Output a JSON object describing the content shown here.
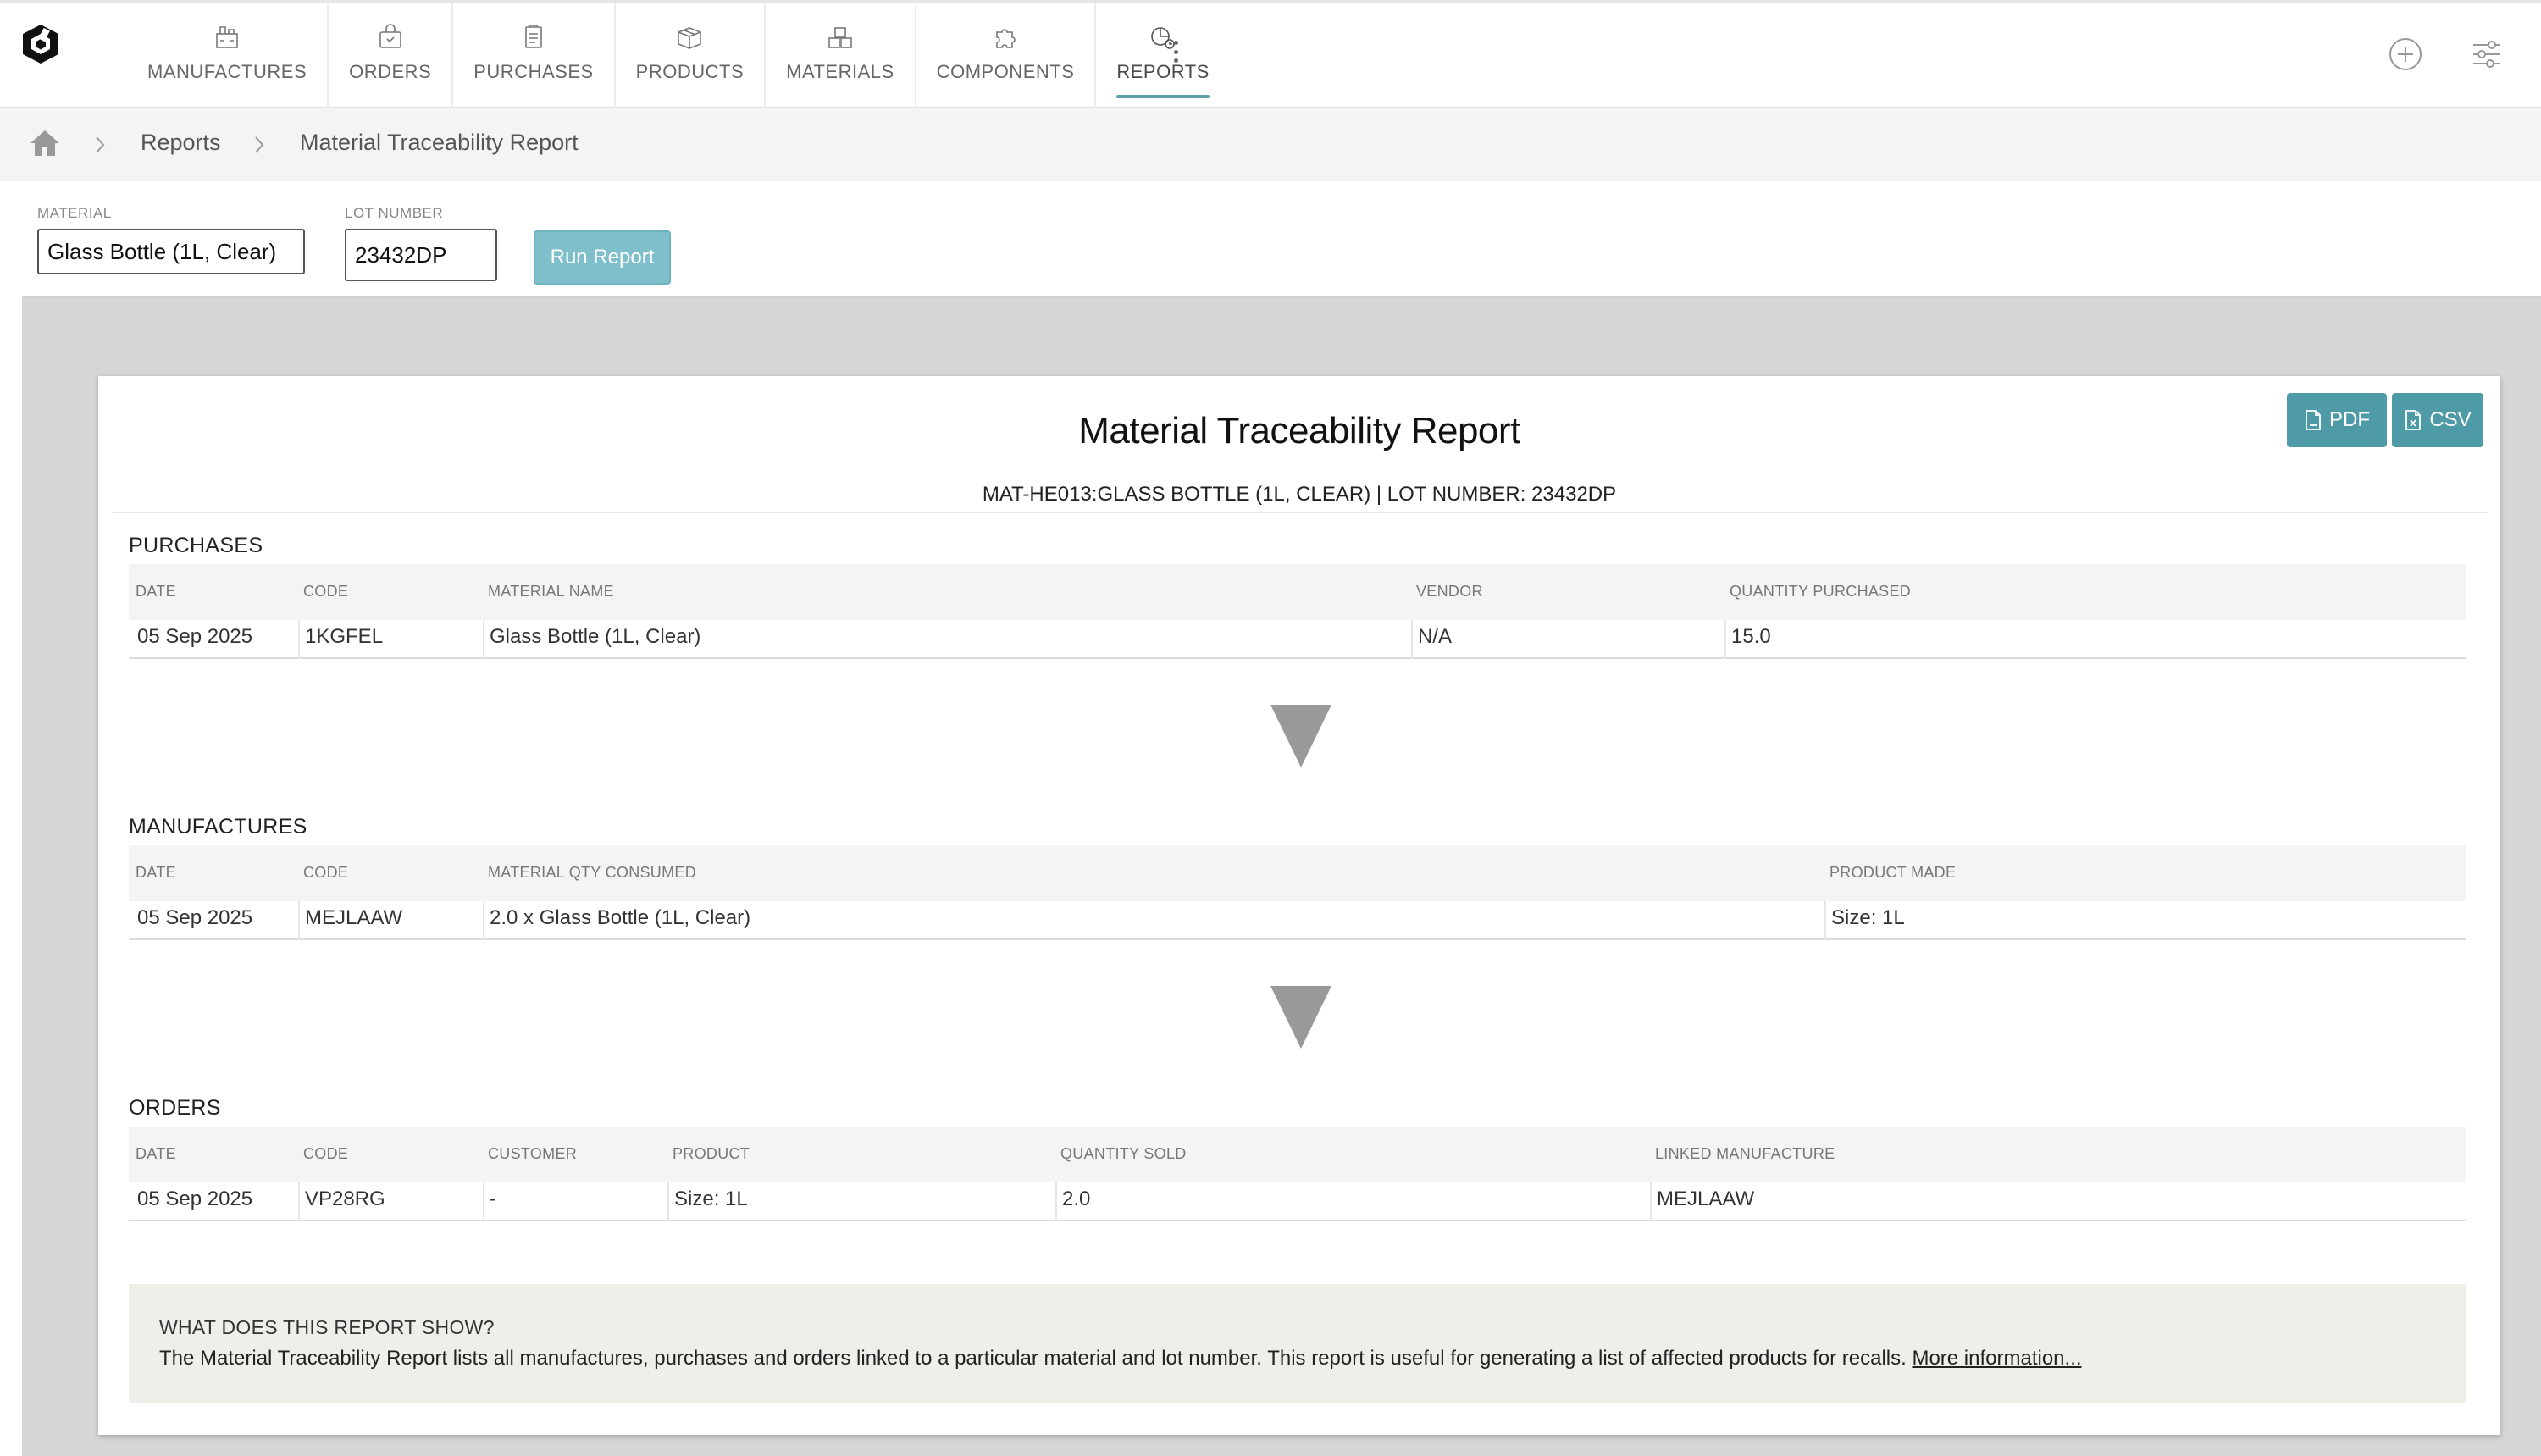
{
  "nav": {
    "items": [
      {
        "label": "MANUFACTURES",
        "icon": "factory-icon"
      },
      {
        "label": "ORDERS",
        "icon": "cart-icon"
      },
      {
        "label": "PURCHASES",
        "icon": "clipboard-icon"
      },
      {
        "label": "PRODUCTS",
        "icon": "box-icon"
      },
      {
        "label": "MATERIALS",
        "icon": "boxes-icon"
      },
      {
        "label": "COMPONENTS",
        "icon": "puzzle-icon"
      },
      {
        "label": "REPORTS",
        "icon": "report-chart-icon",
        "active": true
      }
    ],
    "accent": "#5a9fa8"
  },
  "breadcrumb": {
    "items": [
      "Reports",
      "Material Traceability Report"
    ]
  },
  "filters": {
    "material_label": "MATERIAL",
    "material_value": "Glass Bottle (1L, Clear)",
    "lot_label": "LOT NUMBER",
    "lot_value": "23432DP",
    "run_label": "Run Report"
  },
  "report": {
    "pdf_label": "PDF",
    "csv_label": "CSV",
    "title": "Material Traceability Report",
    "subtitle": "MAT-HE013:GLASS BOTTLE (1L, CLEAR) | LOT NUMBER: 23432DP",
    "purchases": {
      "title": "PURCHASES",
      "headers": [
        "DATE",
        "CODE",
        "MATERIAL NAME",
        "VENDOR",
        "QUANTITY PURCHASED"
      ],
      "rows": [
        [
          "05 Sep 2025",
          "1KGFEL",
          "Glass Bottle (1L, Clear)",
          "N/A",
          "15.0"
        ]
      ]
    },
    "manufactures": {
      "title": "MANUFACTURES",
      "headers": [
        "DATE",
        "CODE",
        "MATERIAL QTY CONSUMED",
        "PRODUCT MADE"
      ],
      "rows": [
        [
          "05 Sep 2025",
          "MEJLAAW",
          "2.0 x Glass Bottle (1L, Clear)",
          "Size: 1L"
        ]
      ]
    },
    "orders": {
      "title": "ORDERS",
      "headers": [
        "DATE",
        "CODE",
        "CUSTOMER",
        "PRODUCT",
        "QUANTITY SOLD",
        "LINKED MANUFACTURE"
      ],
      "rows": [
        [
          "05 Sep 2025",
          "VP28RG",
          "-",
          "Size: 1L",
          "2.0",
          "MEJLAAW"
        ]
      ]
    },
    "info": {
      "title": "WHAT DOES THIS REPORT SHOW?",
      "text": "The Material Traceability Report lists all manufactures, purchases and orders linked to a particular material and lot number. This report is useful for generating a list of affected products for recalls.",
      "link": "More information..."
    }
  }
}
